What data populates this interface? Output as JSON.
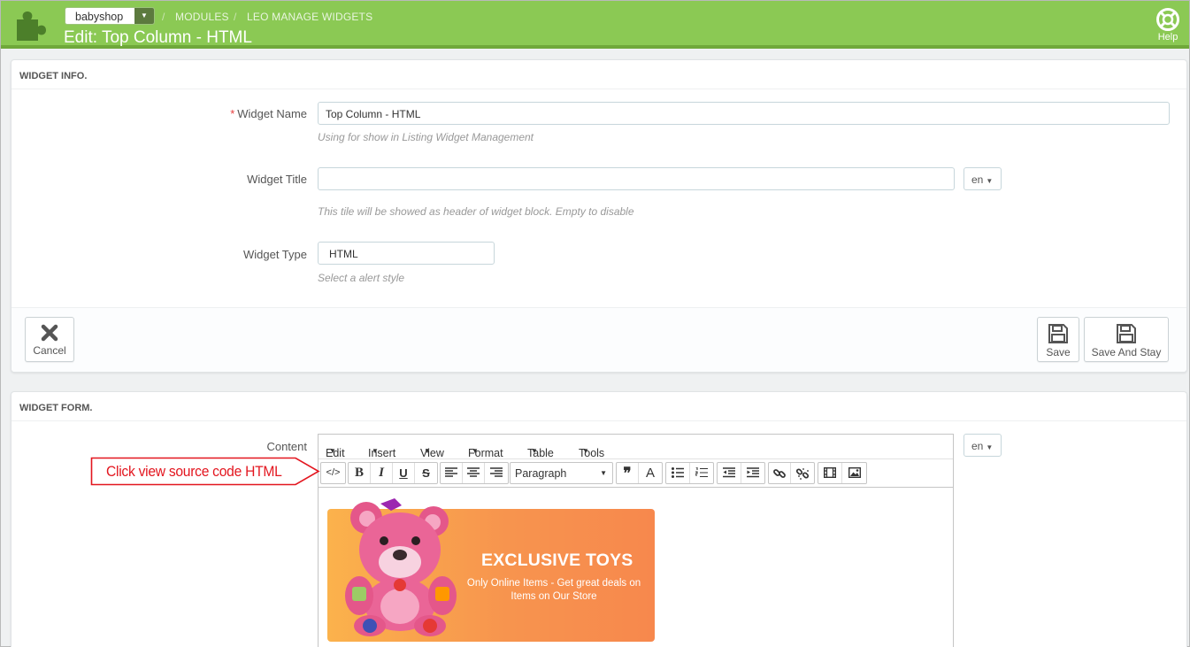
{
  "header": {
    "shop": "babyshop",
    "breadcrumb": [
      "MODULES",
      "LEO MANAGE WIDGETS"
    ],
    "title": "Edit: Top Column - HTML",
    "help_label": "Help"
  },
  "widget_info": {
    "heading": "WIDGET INFO.",
    "name": {
      "required_mark": "*",
      "label": "Widget Name",
      "value": "Top Column - HTML",
      "help": "Using for show in Listing Widget Management"
    },
    "title": {
      "label": "Widget Title",
      "value": "",
      "lang": "en",
      "help": "This tile will be showed as header of widget block. Empty to disable"
    },
    "type": {
      "label": "Widget Type",
      "value": "HTML",
      "help": "Select a alert style"
    },
    "footer": {
      "cancel_label": "Cancel",
      "save_label": "Save",
      "save_stay_label": "Save And Stay"
    }
  },
  "widget_form": {
    "heading": "WIDGET FORM.",
    "content_label": "Content",
    "lang": "en",
    "editor": {
      "menus": [
        "Edit",
        "Insert",
        "View",
        "Format",
        "Table",
        "Tools"
      ],
      "format_select": "Paragraph",
      "banner": {
        "title": "EXCLUSIVE TOYS",
        "subtitle": "Only Online Items - Get great deals on Items on Our Store"
      }
    }
  },
  "annotation": {
    "text": "Click view source code HTML",
    "color": "#e3161f"
  },
  "colors": {
    "header_bg": "#8bc954",
    "banner_start": "#fbb24c",
    "banner_end": "#f7884d"
  }
}
